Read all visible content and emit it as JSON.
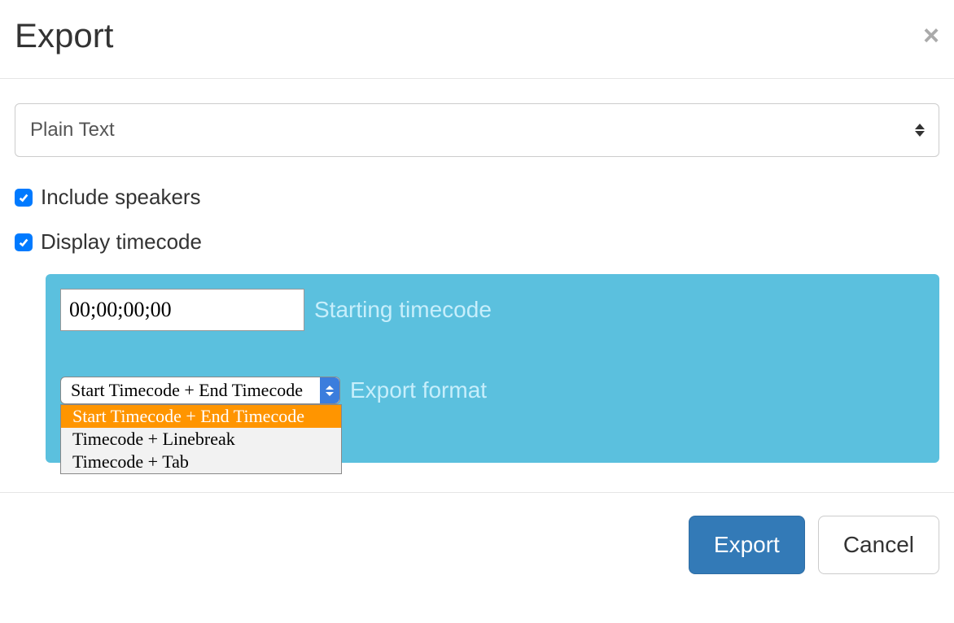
{
  "header": {
    "title": "Export",
    "close_label": "×"
  },
  "format_select": {
    "selected": "Plain Text"
  },
  "options": {
    "include_speakers_label": "Include speakers",
    "include_speakers_checked": true,
    "display_timecode_label": "Display timecode",
    "display_timecode_checked": true
  },
  "timecode_panel": {
    "starting_value": "00;00;00;00",
    "starting_label": "Starting timecode",
    "export_format_label": "Export format",
    "export_format_selected": "Start Timecode + End Timecode",
    "export_format_options": [
      "Start Timecode + End Timecode",
      "Timecode + Linebreak",
      "Timecode + Tab"
    ]
  },
  "footer": {
    "export_label": "Export",
    "cancel_label": "Cancel"
  }
}
